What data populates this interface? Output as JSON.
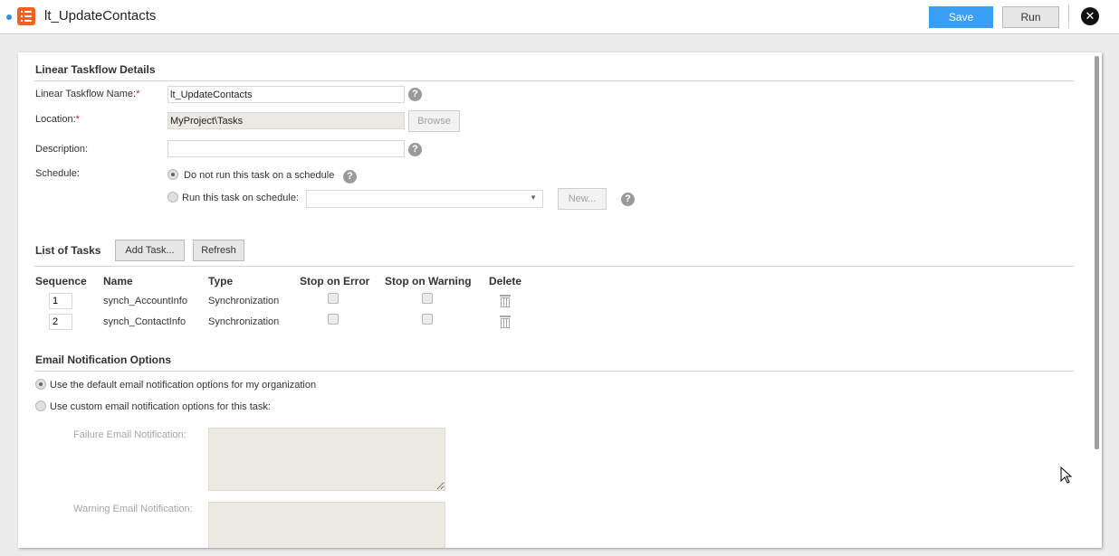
{
  "header": {
    "title": "lt_UpdateContacts",
    "save_label": "Save",
    "run_label": "Run",
    "close_icon": "close-icon",
    "app_icon": "linear-taskflow-icon",
    "accent_color": "#3b9ef5",
    "icon_color": "#f26322"
  },
  "details": {
    "section_title": "Linear Taskflow Details",
    "name_label": "Linear Taskflow Name:",
    "name_value": "lt_UpdateContacts",
    "location_label": "Location:",
    "location_value": "MyProject\\Tasks",
    "browse_label": "Browse",
    "description_label": "Description:",
    "description_value": "",
    "required_mark": "*",
    "help_glyph": "?",
    "schedule_label": "Schedule:",
    "schedule_option_none": "Do not run this task on a schedule",
    "schedule_option_run": "Run this task on schedule:",
    "schedule_selected": "none",
    "schedule_select_value": "",
    "new_label": "New...",
    "dropdown_glyph": "▼"
  },
  "tasks": {
    "section_title": "List of Tasks",
    "add_task_label": "Add Task...",
    "refresh_label": "Refresh",
    "columns": [
      "Sequence",
      "Name",
      "Type",
      "Stop on Error",
      "Stop on Warning",
      "Delete"
    ],
    "rows": [
      {
        "sequence": "1",
        "name": "synch_AccountInfo",
        "type": "Synchronization",
        "stop_on_error": false,
        "stop_on_warning": false
      },
      {
        "sequence": "2",
        "name": "synch_ContactInfo",
        "type": "Synchronization",
        "stop_on_error": false,
        "stop_on_warning": false
      }
    ]
  },
  "email": {
    "section_title": "Email Notification Options",
    "option_default": "Use the default email notification options for my organization",
    "option_custom": "Use custom email notification options for this task:",
    "selected": "default",
    "failure_label": "Failure Email Notification:",
    "failure_value": "",
    "warning_label": "Warning Email Notification:",
    "warning_value": ""
  }
}
